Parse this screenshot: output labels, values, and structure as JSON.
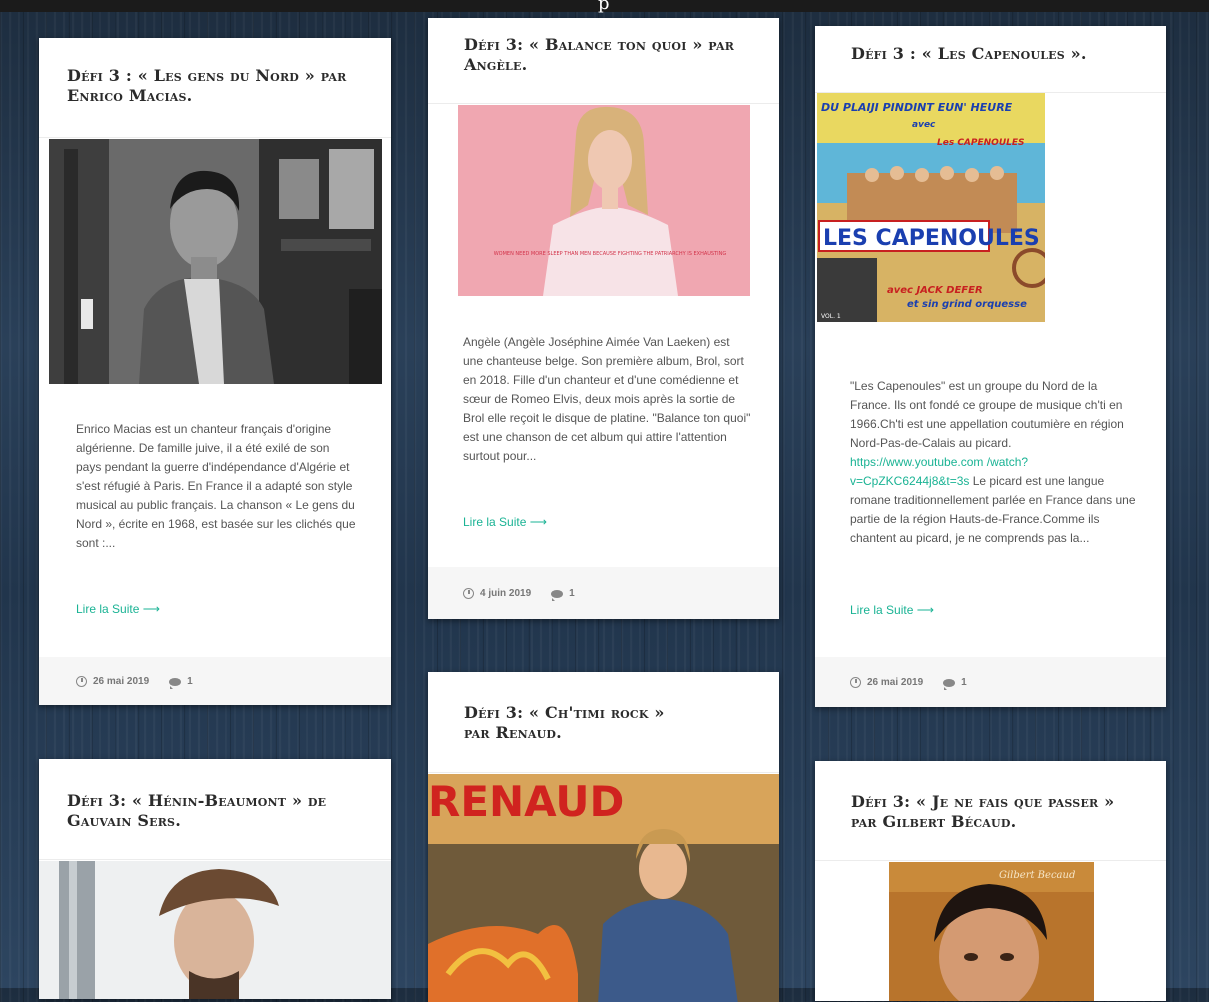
{
  "top_glyph": "p",
  "posts": {
    "p1": {
      "title": "Défi 3 : « Les gens du Nord » par Enrico Macias.",
      "excerpt": "Enrico Macias est un chanteur français d'origine algérienne. De famille juive, il a été exilé de son pays pendant la guerre d'indépendance d'Algérie et s'est réfugié à Paris. En France il a adapté son style musical au public français. La chanson « Le gens du Nord », écrite en 1968, est basée sur les clichés que sont :...",
      "read_more": "Lire la Suite ⟶",
      "date": "26 mai 2019",
      "comments": "1"
    },
    "p2": {
      "title": "Défi 3: « Balance ton quoi » par Angèle.",
      "excerpt": "Angèle (Angèle Joséphine Aimée Van Laeken) est une chanteuse belge. Son première album, Brol, sort en 2018. Fille d'un chanteur et d'une comédienne et sœur de Romeo Elvis, deux mois après la sortie de Brol elle reçoit le disque de platine. \"Balance ton quoi\" est une chanson de cet album qui attire l'attention surtout pour...",
      "read_more": "Lire la Suite ⟶",
      "date": "4 juin 2019",
      "comments": "1",
      "shirt_text": "WOMEN NEED MORE SLEEP THAN MEN BECAUSE FIGHTING THE PATRIARCHY IS EXHAUSTING"
    },
    "p3": {
      "title": "Défi 3 : « Les Capenoules ».",
      "excerpt_a": "\"Les Capenoules\" est un groupe du Nord de la France. Ils ont fondé ce groupe de musique ch'ti en 1966.Ch'ti est une appellation coutumière en région Nord-Pas-de-Calais au picard. ",
      "link": "https://www.youtube.com /watch?v=CpZKC6244j8&t=3s",
      "excerpt_b": " Le picard est une langue romane traditionnellement parlée en France dans une partie de la région Hauts-de-France.Comme ils chantent au picard, je ne comprends pas la...",
      "read_more": "Lire la Suite ⟶",
      "date": "26 mai 2019",
      "comments": "1",
      "cover_top": "DU PLAIJI PINDINT EUN' HEURE",
      "cover_avec": "avec",
      "cover_group": "Les CAPENOULES",
      "cover_logo": "LES CAPENOULES",
      "cover_bottom1": "avec JACK DEFER",
      "cover_bottom2": "et sin grind orquesse",
      "cover_vol": "VOL. 1"
    },
    "p4": {
      "title": "Défi 3: « Ch'timi rock » par Renaud.",
      "cover_name": "RENAUD"
    },
    "p5": {
      "title": "Défi 3: « Hénin-Beaumont » de Gauvain Sers."
    },
    "p6": {
      "title": "Défi 3: « Je ne fais que passer » par Gilbert Bécaud.",
      "cover_sig": "Gilbert Becaud"
    }
  },
  "colors": {
    "accent": "#1ab394",
    "title": "#2b2b2b",
    "text": "#555555"
  }
}
